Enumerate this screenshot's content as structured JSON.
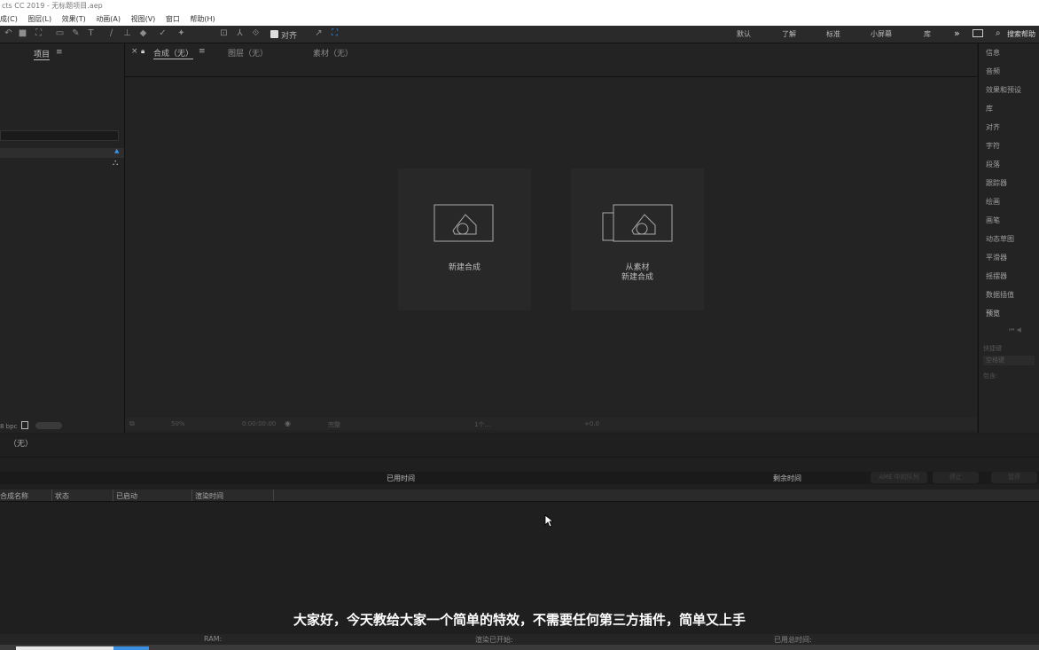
{
  "window": {
    "title": "cts CC 2019 - 无标题项目.aep"
  },
  "menu": [
    "成(C)",
    "图层(L)",
    "效果(T)",
    "动画(A)",
    "视图(V)",
    "窗口",
    "帮助(H)"
  ],
  "toolbar": {
    "snap_label": "对齐",
    "workspaces": [
      "默认",
      "了解",
      "标准",
      "小屏幕",
      "库"
    ],
    "search_placeholder": "搜索帮助"
  },
  "project_panel": {
    "tab": "项目",
    "bpc": "8 bpc"
  },
  "viewer": {
    "tabs": [
      {
        "label": "合成（无）",
        "active": true
      },
      {
        "label": "图层（无）",
        "active": false
      },
      {
        "label": "素材（无）",
        "active": false
      }
    ],
    "cards": [
      {
        "line1": "新建合成",
        "line2": ""
      },
      {
        "line1": "从素材",
        "line2": "新建合成"
      }
    ],
    "footer": {
      "zoom": "50%",
      "timecode": "0:00:00:00",
      "quality": "完整",
      "camera": "1个...",
      "exposure": "+0.0"
    }
  },
  "right_panel": [
    "信息",
    "音频",
    "效果和预设",
    "库",
    "对齐",
    "字符",
    "段落",
    "跟踪器",
    "绘画",
    "画笔",
    "动态草图",
    "平滑器",
    "摇摆器",
    "数据插值",
    "预览"
  ],
  "preview_sub": [
    "快捷键",
    "空格键",
    "包含:"
  ],
  "timeline": {
    "title": "（无）"
  },
  "render_queue": {
    "elapsed_label": "已用时间",
    "remaining_label": "剩余时间",
    "buttons": [
      "AME 中的队列",
      "停止",
      "暂停"
    ],
    "columns": [
      "合成名称",
      "状态",
      "已启动",
      "渲染时间"
    ]
  },
  "subtitle": "大家好，今天教给大家一个简单的特效，不需要任何第三方插件，简单又上手",
  "status": {
    "ram": "RAM:",
    "render_started": "渲染已开始:",
    "total_time": "已用总时间:"
  }
}
